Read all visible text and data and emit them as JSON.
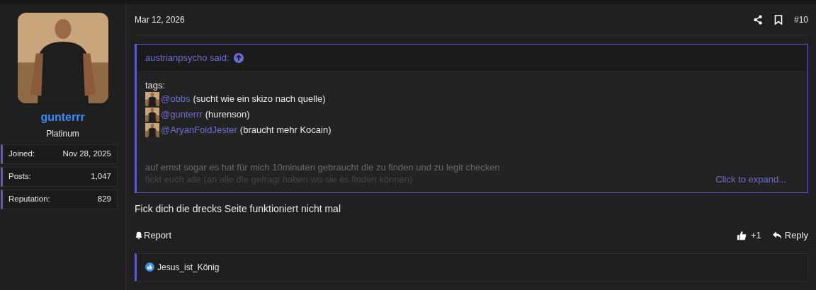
{
  "author": {
    "username": "gunterrr",
    "rank": "Platinum",
    "stats": [
      {
        "label": "Joined:",
        "value": "Nov 28, 2025"
      },
      {
        "label": "Posts:",
        "value": "1,047"
      },
      {
        "label": "Reputation:",
        "value": "829"
      }
    ]
  },
  "post": {
    "date": "Mar 12, 2026",
    "number": "#10",
    "quote": {
      "author": "austrianpsycho said:",
      "intro": "tags:",
      "mentions": [
        {
          "user": "@obbs",
          "note": "(sucht wie ein skizo nach quelle)"
        },
        {
          "user": "@gunterrr",
          "note": "(hurenson)"
        },
        {
          "user": "@AryanFoidJester",
          "note": "(braucht mehr Kocain)"
        }
      ],
      "faded_lines": [
        "auf ernst sogar es hat für mich 10minuten gebraucht die zu finden und zu legit checken",
        "fickt euch alle (an alle die gefragt haben wo sie es finden können)"
      ],
      "expand": "Click to expand..."
    },
    "message": "Fick dich die drecks Seite funktioniert nicht mal",
    "actions": {
      "report": "Report",
      "reaction_count": "+1",
      "reply": "Reply"
    },
    "reactions": {
      "users": "Jesus_ist_König"
    }
  }
}
